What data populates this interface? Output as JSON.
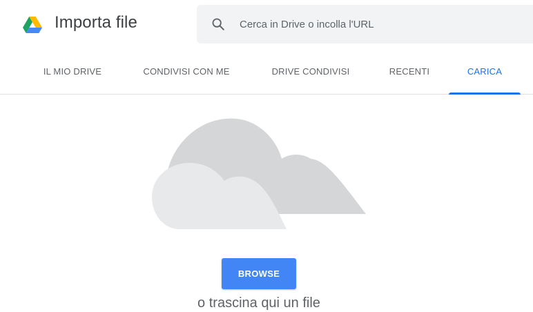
{
  "header": {
    "title": "Importa file",
    "logo_icon": "google-drive-logo"
  },
  "search": {
    "placeholder": "Cerca in Drive o incolla l'URL",
    "value": "",
    "icon": "search-icon"
  },
  "tabs": [
    {
      "label": "IL MIO DRIVE",
      "active": false
    },
    {
      "label": "CONDIVISI CON ME",
      "active": false
    },
    {
      "label": "DRIVE CONDIVISI",
      "active": false
    },
    {
      "label": "RECENTI",
      "active": false
    },
    {
      "label": "CARICA",
      "active": true
    }
  ],
  "upload": {
    "illustration": "cloud-illustration",
    "browse_label": "BROWSE",
    "drop_hint": "o trascina qui un file"
  },
  "colors": {
    "accent": "#1a73e8",
    "button": "#4285f4",
    "search_bg": "#f1f3f4",
    "text_muted": "#5f6368"
  }
}
